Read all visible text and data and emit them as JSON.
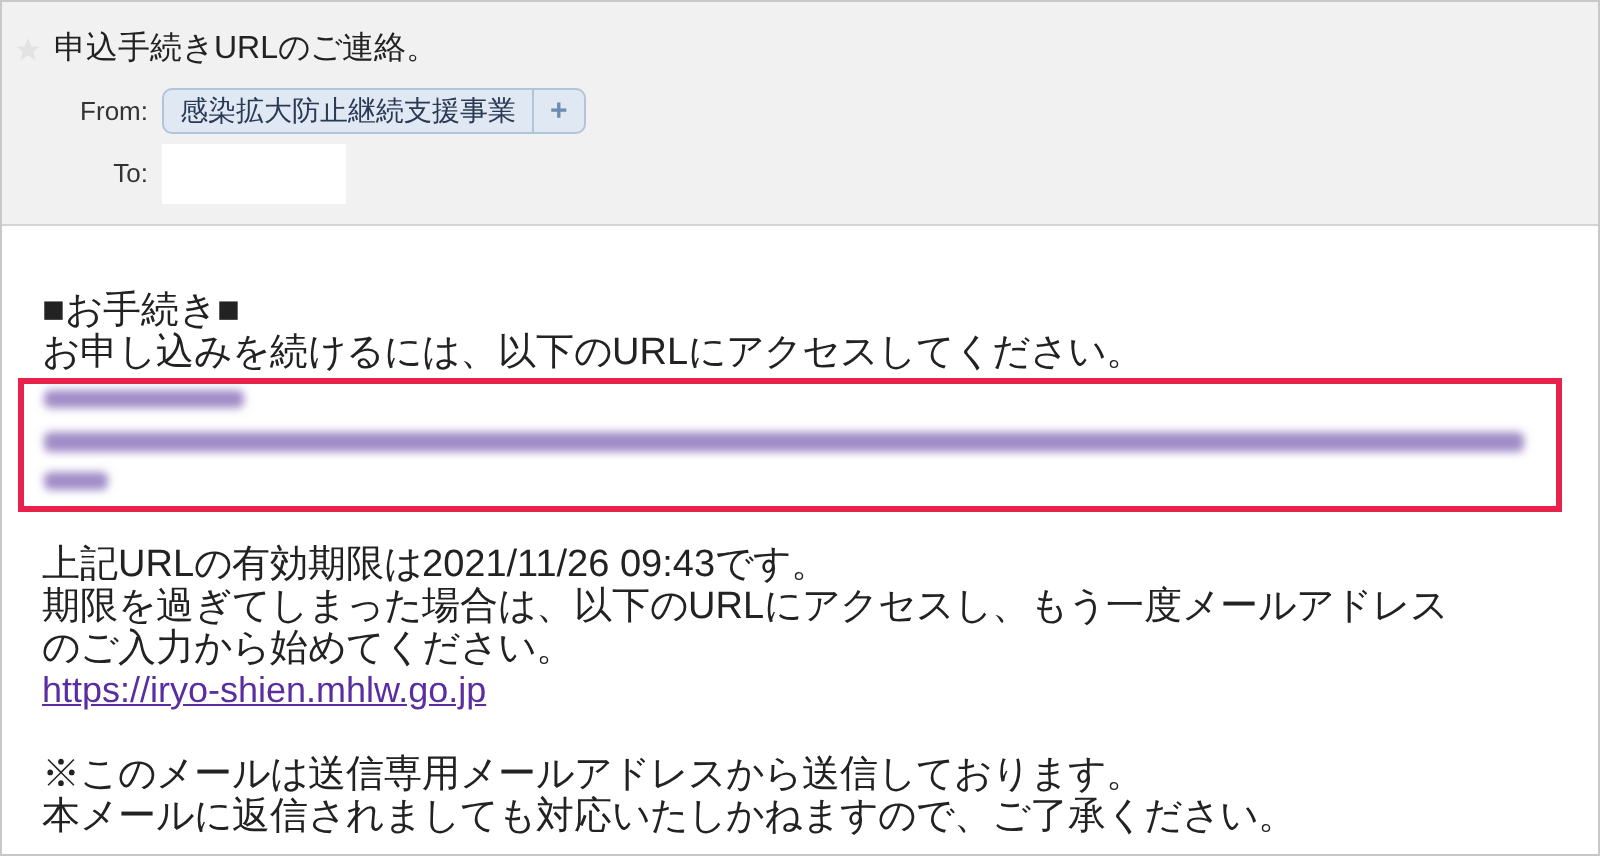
{
  "subject": "申込手続きURLのご連絡。",
  "from": {
    "label": "From:",
    "sender": "感染拡大防止継続支援事業",
    "add": "+"
  },
  "to": {
    "label": "To:"
  },
  "body": [
    {
      "kind": "text",
      "lines": [
        "■お手続き■",
        "お申し込みを続けるには、以下のURLにアクセスしてください。"
      ]
    },
    {
      "kind": "redacted_link"
    },
    {
      "kind": "text",
      "lines": [
        "上記URLの有効期限は2021/11/26 09:43です。",
        "期限を過ぎてしまった場合は、以下のURLにアクセスし、もう一度メールアドレス",
        "のご入力から始めてください。"
      ]
    },
    {
      "kind": "link",
      "text": "https://iryo-shien.mhlw.go.jp"
    },
    {
      "kind": "text",
      "lines": [
        "※このメールは送信専用メールアドレスから送信しております。",
        "本メールに返信されましても対応いたしかねますので、ご了承ください。"
      ]
    }
  ]
}
